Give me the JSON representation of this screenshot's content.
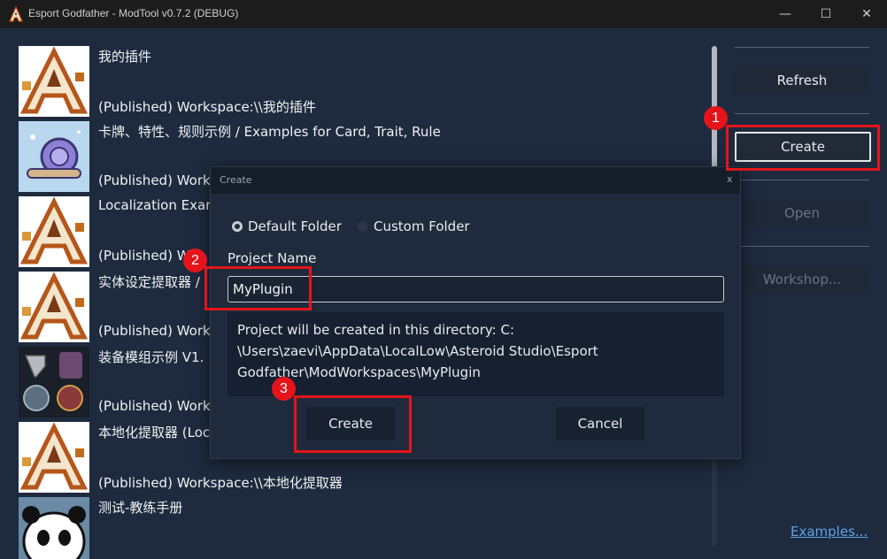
{
  "window": {
    "title": "Esport Godfather - ModTool v0.7.2 (DEBUG)",
    "minimize_glyph": "—",
    "maximize_glyph": "☐",
    "close_glyph": "✕"
  },
  "list": {
    "items": [
      {
        "name": "我的插件",
        "status": "(Published) Workspace:\\\\我的插件",
        "thumb": "a-logo"
      },
      {
        "name": "卡牌、特性、规则示例 / Examples for Card, Trait, Rule",
        "status": "(Published) Work",
        "thumb": "snail"
      },
      {
        "name": "Localization Exar",
        "status": "(Published) W",
        "thumb": "a-logo"
      },
      {
        "name": "实体设定提取器 /",
        "status": "(Published) Work",
        "thumb": "a-logo"
      },
      {
        "name": "装备模组示例 V1.",
        "status": "(Published) Work",
        "thumb": "equipment"
      },
      {
        "name": "本地化提取器 (Loc",
        "status": "(Published) Workspace:\\\\本地化提取器",
        "thumb": "a-logo"
      },
      {
        "name": "测试-教练手册",
        "status": "",
        "thumb": "panda"
      }
    ]
  },
  "sidebar": {
    "refresh_label": "Refresh",
    "create_label": "Create",
    "open_label": "Open",
    "workshop_label": "Workshop...",
    "examples_label": "Examples..."
  },
  "dialog": {
    "title": "Create",
    "close_glyph": "x",
    "radio_default": "Default Folder",
    "radio_custom": "Custom Folder",
    "selected_radio": "Default Folder",
    "project_name_label": "Project Name",
    "project_name_value": "MyPlugin",
    "info_line1": "Project will be created in this directory: C:",
    "info_line2": "\\Users\\zaevi\\AppData\\LocalLow\\Asteroid Studio\\Esport",
    "info_line3": "Godfather\\ModWorkspaces\\MyPlugin",
    "create_label": "Create",
    "cancel_label": "Cancel"
  },
  "annotations": {
    "step1": "1",
    "step2": "2",
    "step3": "3",
    "color": "#e5141b"
  },
  "colors": {
    "background": "#1e2a3e",
    "link": "#5da3e8"
  }
}
